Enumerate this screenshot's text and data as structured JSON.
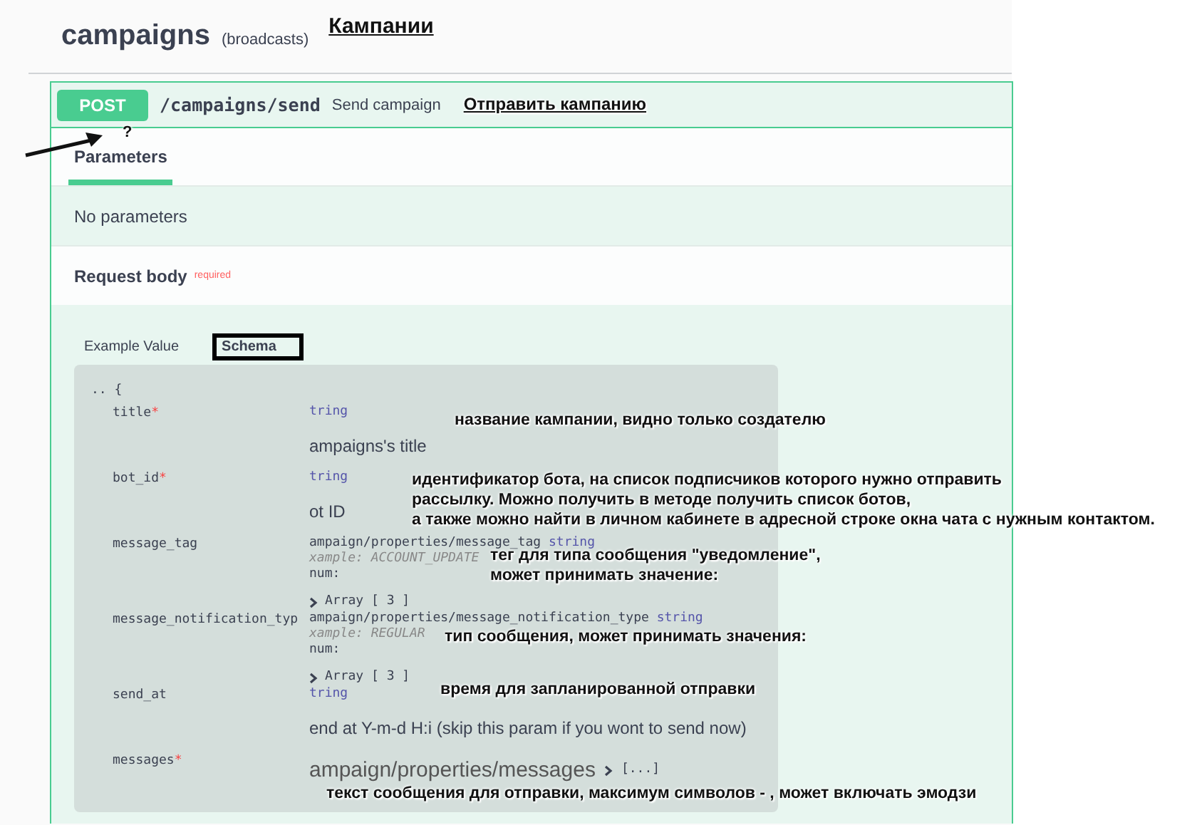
{
  "section": {
    "title": "campaigns",
    "subtitle": "(broadcasts)",
    "note": "Кампании"
  },
  "operation": {
    "method": "POST",
    "path": "/campaigns/send",
    "summary": "Send campaign",
    "note": "Отправить кампанию"
  },
  "pointer": {
    "label": "?"
  },
  "tabs": [
    {
      "label": "Parameters",
      "selected": true
    }
  ],
  "parameters": {
    "empty_text": "No parameters"
  },
  "request_body": {
    "title": "Request body",
    "required": "required"
  },
  "model_tabs": [
    {
      "label": "Example Value",
      "selected": false
    },
    {
      "label": "Schema",
      "selected": true
    }
  ],
  "schema": {
    "opening": ".. {",
    "rows": [
      {
        "name": "title",
        "required_mark": "*",
        "note": "название кампании, видно только создателю",
        "lines": [
          {
            "kind": "type",
            "text": "tring"
          },
          {
            "kind": "desc",
            "text": "ampaigns's title"
          }
        ]
      },
      {
        "name": "bot_id",
        "required_mark": "*",
        "note": "идентификатор бота, на список подписчиков которого нужно отправить\nрассылку. Можно получить в методе получить список ботов,\nа также можно найти в личном кабинете в адресной строке окна чата с нужным контактом.",
        "lines": [
          {
            "kind": "type",
            "text": "tring"
          },
          {
            "kind": "desc",
            "text": "ot ID"
          }
        ]
      },
      {
        "name": "message_tag",
        "note": "тег для типа сообщения \"уведомление\",\nможет принимать значение:",
        "lines": [
          {
            "kind": "ref",
            "text": "ampaign/properties/message_tag",
            "type": "string"
          },
          {
            "kind": "example",
            "text": "xample: ACCOUNT_UPDATE"
          },
          {
            "kind": "enum",
            "text": "num:"
          },
          {
            "kind": "array",
            "text": "Array [ 3 ]"
          }
        ]
      },
      {
        "name": "message_notification_typ",
        "note": "тип сообщения, может принимать значения:",
        "lines": [
          {
            "kind": "ref",
            "text": "ampaign/properties/message_notification_type",
            "type": "string"
          },
          {
            "kind": "example",
            "text": "xample: REGULAR"
          },
          {
            "kind": "enum",
            "text": "num:"
          },
          {
            "kind": "array",
            "text": "Array [ 3 ]"
          }
        ]
      },
      {
        "name": "send_at",
        "note": "время для запланированной отправки",
        "lines": [
          {
            "kind": "type",
            "text": "tring"
          },
          {
            "kind": "desc",
            "text": "end at Y-m-d H:i (skip this param if you wont to send now)"
          }
        ]
      },
      {
        "name": "messages",
        "required_mark": "*",
        "note": "текст сообщения для отправки, максимум символов - , может включать эмодзи",
        "lines": [
          {
            "kind": "model",
            "text": "ampaign/properties/messages",
            "more": "[...]"
          }
        ]
      }
    ]
  }
}
